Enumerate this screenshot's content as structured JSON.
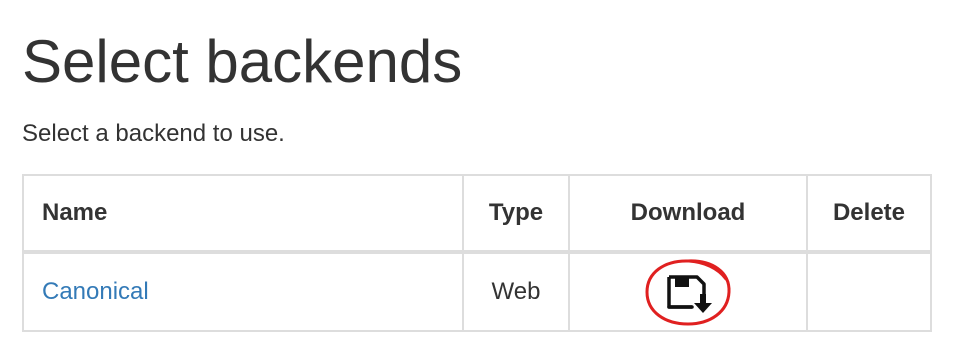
{
  "page": {
    "title": "Select backends",
    "description": "Select a backend to use."
  },
  "table": {
    "headers": {
      "name": "Name",
      "type": "Type",
      "download": "Download",
      "delete": "Delete"
    },
    "rows": [
      {
        "name": "Canonical",
        "type": "Web",
        "download_icon": "floppy-download-icon",
        "delete": ""
      }
    ]
  },
  "colors": {
    "link": "#337ab7",
    "text": "#333333",
    "border": "#dddddd",
    "highlight_circle": "#e02020"
  }
}
